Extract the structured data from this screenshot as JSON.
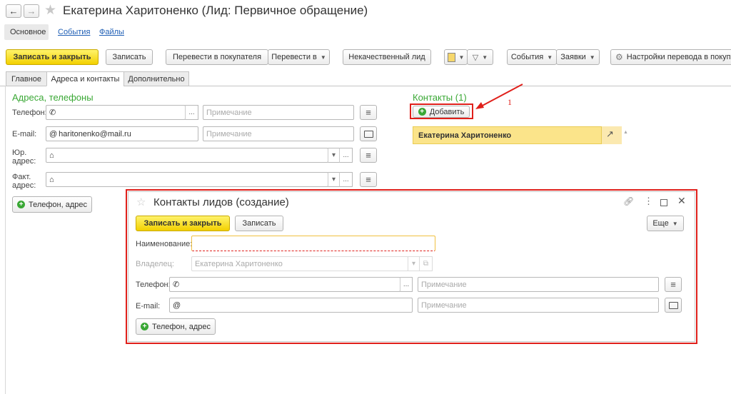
{
  "window": {
    "back": "←",
    "forward": "→",
    "title": "Екатерина Харитоненко (Лид: Первичное обращение)"
  },
  "nav_links": {
    "main": "Основное",
    "events": "События",
    "files": "Файлы"
  },
  "toolbar": {
    "save_close": "Записать и закрыть",
    "save": "Записать",
    "to_customer": "Перевести в покупателя",
    "transfer_to": "Перевести в",
    "low_quality": "Некачественный лид",
    "events": "События",
    "requests": "Заявки",
    "transfer_settings": "Настройки перевода в покупа"
  },
  "tabs": [
    "Главное",
    "Адреса и контакты",
    "Дополнительно"
  ],
  "addresses": {
    "heading": "Адреса, телефоны",
    "phone_label": "Телефон:",
    "email_label": "E-mail:",
    "email_value": "haritonenko@mail.ru",
    "legal_label_1": "Юр.",
    "legal_label_2": "адрес:",
    "actual_label_1": "Факт.",
    "actual_label_2": "адрес:",
    "note_placeholder": "Примечание",
    "ellipsis": "...",
    "add_phone_button": "Телефон, адрес"
  },
  "contacts": {
    "heading": "Контакты (1)",
    "add_button": "Добавить",
    "annotation_number": "1",
    "items": [
      "Екатерина Харитоненко"
    ]
  },
  "dialog": {
    "title": "Контакты лидов (создание)",
    "save_close": "Записать и закрыть",
    "save": "Записать",
    "more": "Еще",
    "name_label": "Наименование:",
    "owner_label": "Владелец:",
    "owner_value": "Екатерина Харитоненко",
    "phone_label": "Телефон:",
    "email_label": "E-mail:",
    "note_placeholder": "Примечание",
    "ellipsis": "...",
    "add_phone_button": "Телефон, адрес"
  },
  "colors": {
    "accent_yellow": "#f5d800",
    "heading_green": "#3aa835",
    "highlight_red": "#e0201b",
    "contact_bg": "#fbe48a"
  }
}
